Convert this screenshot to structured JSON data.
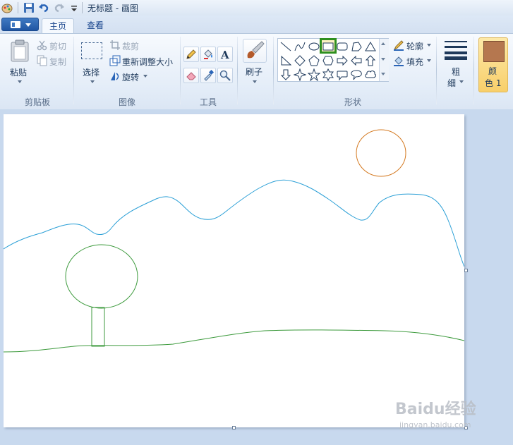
{
  "window": {
    "title": "无标题 - 画图"
  },
  "tabs": [
    {
      "label": "主页"
    },
    {
      "label": "查看"
    }
  ],
  "clipboard": {
    "paste": "粘贴",
    "cut": "剪切",
    "copy": "复制",
    "group": "剪贴板"
  },
  "image": {
    "select": "选择",
    "crop": "裁剪",
    "resize": "重新调整大小",
    "rotate": "旋转",
    "group": "图像"
  },
  "tools": {
    "group": "工具"
  },
  "brushes": {
    "label": "刷子"
  },
  "shapes": {
    "group": "形状",
    "outline": "轮廓",
    "fill": "填充",
    "selected": "rectangle"
  },
  "size": {
    "label1": "粗",
    "label2": "细"
  },
  "color1": {
    "label1": "颜",
    "label2": "色 1",
    "swatch": "#b5774f"
  },
  "drawing": {
    "mountain_color": "#2a9fd6",
    "sun_color": "#d47a22",
    "tree_color": "#3c9a3c",
    "ground_color": "#3c9a3c"
  },
  "watermark": {
    "brand": "Baidu经验",
    "url": "jingyan.baidu.com"
  }
}
